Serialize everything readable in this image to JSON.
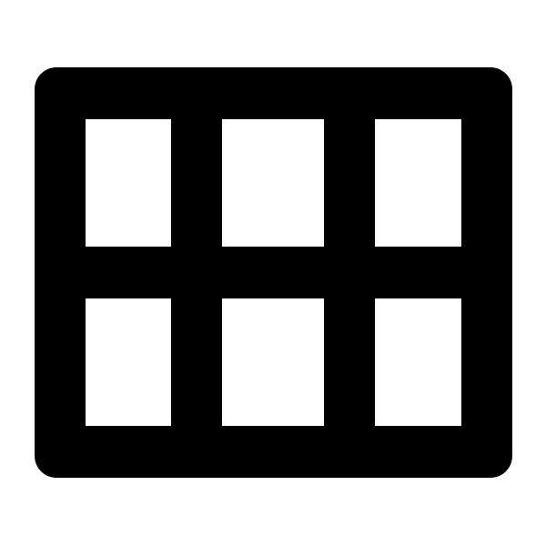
{
  "icon": {
    "name": "grid-view-icon",
    "foreground": "#000000",
    "background": "#ffffff",
    "columns": 3,
    "rows": 2
  }
}
